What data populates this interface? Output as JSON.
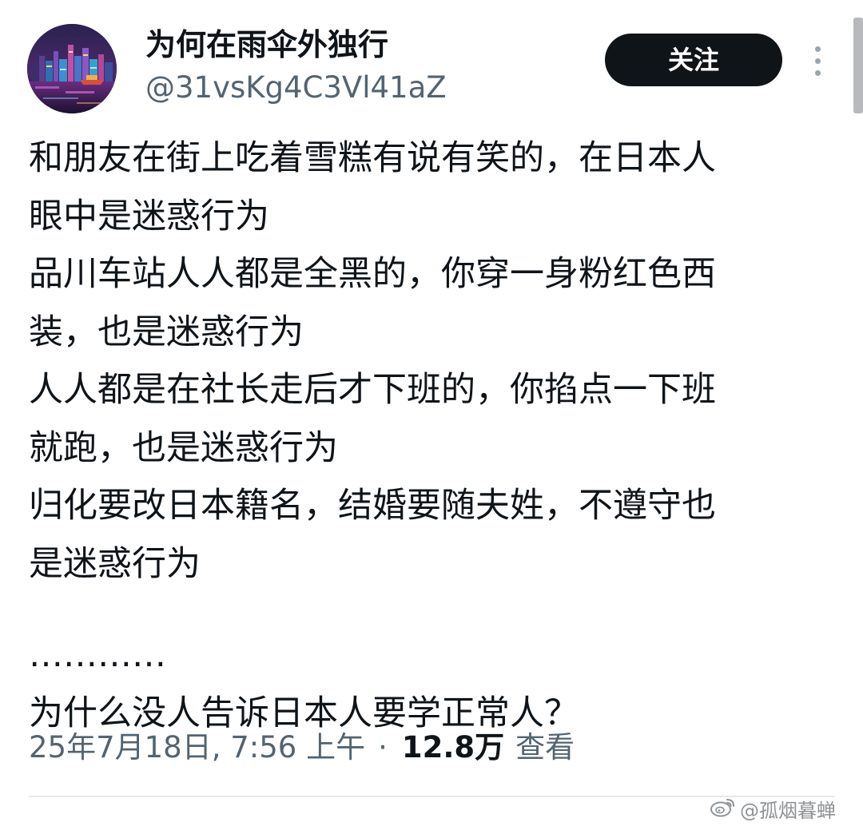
{
  "author": {
    "display_name": "为何在雨伞外独行",
    "handle": "@31vsKg4C3Vl41aZ"
  },
  "actions": {
    "follow_label": "关注",
    "more_icon": "more-vertical-icon"
  },
  "tweet": {
    "lines": [
      "和朋友在街上吃着雪糕有说有笑的，在日本人",
      "眼中是迷惑行为",
      "品川车站人人都是全黑的，你穿一身粉红色西",
      "装，也是迷惑行为",
      "人人都是在社长走后才下班的，你掐点一下班",
      "就跑，也是迷惑行为",
      "归化要改日本籍名，结婚要随夫姓，不遵守也",
      "是迷惑行为",
      "…………",
      "为什么没人告诉日本人要学正常人？"
    ],
    "timestamp": "25年7月18日, 7:56 上午",
    "separator": "·",
    "views_count": "12.8万",
    "views_label": "查看"
  },
  "watermark": {
    "logo_icon": "weibo-logo-icon",
    "text": "@孤烟暮蝉"
  },
  "colors": {
    "text_primary": "#0f1419",
    "text_secondary": "#536471",
    "follow_button_bg": "#0f1419",
    "follow_button_text": "#ffffff",
    "divider": "#e6e8ea"
  }
}
